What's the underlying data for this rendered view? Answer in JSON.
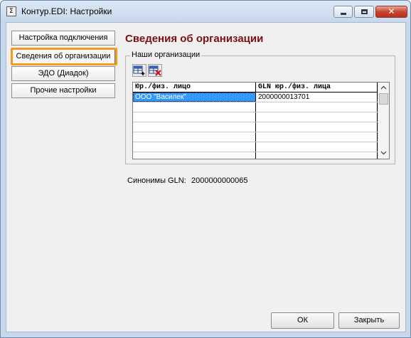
{
  "window": {
    "title": "Контур.EDI: Настройки",
    "app_icon_glyph": "Σ",
    "close_glyph": "✕"
  },
  "nav": {
    "items": [
      {
        "label": "Настройка подключения"
      },
      {
        "label": "Сведения об организации",
        "active": true
      },
      {
        "label": "ЭДО (Диадок)"
      },
      {
        "label": "Прочие настройки"
      }
    ]
  },
  "main": {
    "section_title": "Сведения об организации",
    "group_label": "Наши организации",
    "toolbar": [
      {
        "icon": "add-row-icon"
      },
      {
        "icon": "delete-row-icon"
      }
    ],
    "grid": {
      "columns": [
        "Юр./физ. лицо",
        "GLN юр./физ. лица"
      ],
      "rows": [
        [
          "ООО \"Василек\"",
          "2000000013701"
        ]
      ],
      "selected_row": 0
    },
    "synonyms_label": "Синонимы GLN:",
    "synonyms_value": "2000000000065"
  },
  "footer": {
    "ok_label": "ОК",
    "close_label": "Закрыть"
  },
  "colors": {
    "section_title": "#7a1010",
    "highlight": "#f39a22",
    "selection": "#3399ff"
  }
}
